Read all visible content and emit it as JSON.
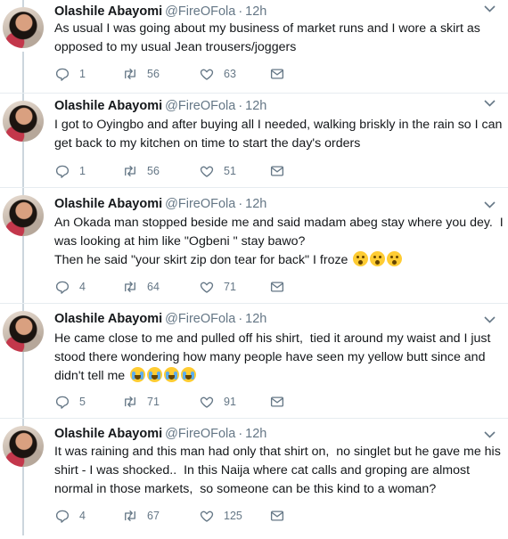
{
  "tweets": [
    {
      "name": "Olashile Abayomi",
      "handle": "@FireOFola",
      "time": "12h",
      "text": "As usual I was going about my business of market runs and I wore a skirt as opposed to my usual Jean trousers/joggers",
      "replies": "1",
      "retweets": "56",
      "likes": "63"
    },
    {
      "name": "Olashile Abayomi",
      "handle": "@FireOFola",
      "time": "12h",
      "text": "I got to Oyingbo and after buying all I needed, walking briskly in the rain so I can get back to my kitchen on time to start the day's orders",
      "replies": "1",
      "retweets": "56",
      "likes": "51"
    },
    {
      "name": "Olashile Abayomi",
      "handle": "@FireOFola",
      "time": "12h",
      "text": "An Okada man stopped beside me and said madam abeg stay where you dey.  I was looking at him like \"Ogbeni \" stay bawo?\nThen he said \"your skirt zip don tear for back\" I froze ",
      "replies": "4",
      "retweets": "64",
      "likes": "71"
    },
    {
      "name": "Olashile Abayomi",
      "handle": "@FireOFola",
      "time": "12h",
      "text": "He came close to me and pulled off his shirt,  tied it around my waist and I just stood there wondering how many people have seen my yellow butt since and didn't tell me ",
      "replies": "5",
      "retweets": "71",
      "likes": "91"
    },
    {
      "name": "Olashile Abayomi",
      "handle": "@FireOFola",
      "time": "12h",
      "text": "It was raining and this man had only that shirt on,  no singlet but he gave me his shirt - I was shocked..  In this Naija where cat calls and groping are almost normal in those markets,  so someone can be this kind to a woman?",
      "replies": "4",
      "retweets": "67",
      "likes": "125"
    }
  ],
  "time_separator": "·",
  "icons": {
    "reply": "reply-icon",
    "retweet": "retweet-icon",
    "like": "heart-icon",
    "dm": "envelope-icon",
    "menu": "chevron-down-icon",
    "emoji_3": "astonished-face-emoji",
    "emoji_4": "loudly-crying-face-emoji"
  },
  "colors": {
    "text": "#14171a",
    "secondary": "#657786",
    "thread_line": "#ccd6dd",
    "separator": "#e6ecf0"
  }
}
